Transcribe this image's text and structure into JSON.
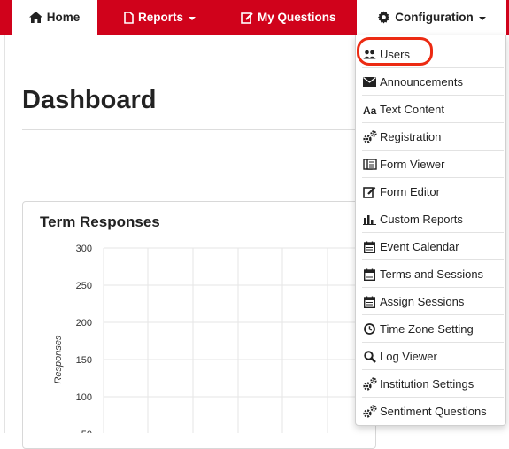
{
  "nav": {
    "home": "Home",
    "reports": "Reports",
    "my_questions": "My Questions",
    "configuration": "Configuration"
  },
  "page": {
    "title": "Dashboard"
  },
  "panel": {
    "title": "Term Responses"
  },
  "chart_data": {
    "type": "bar",
    "title": "Term Responses",
    "ylabel": "Responses",
    "ylim": [
      0,
      300
    ],
    "yticks": [
      300,
      250,
      200,
      150,
      100,
      50
    ],
    "grid": true
  },
  "menu": {
    "items": [
      {
        "label": "Users",
        "icon": "users-icon"
      },
      {
        "label": "Announcements",
        "icon": "envelope-icon"
      },
      {
        "label": "Text Content",
        "icon": "font-icon"
      },
      {
        "label": "Registration",
        "icon": "cogs-icon"
      },
      {
        "label": "Form Viewer",
        "icon": "forms-icon"
      },
      {
        "label": "Form Editor",
        "icon": "edit-icon"
      },
      {
        "label": "Custom Reports",
        "icon": "bar-chart-icon"
      },
      {
        "label": "Event Calendar",
        "icon": "calendar-icon"
      },
      {
        "label": "Terms and Sessions",
        "icon": "calendar-icon"
      },
      {
        "label": "Assign Sessions",
        "icon": "calendar-icon"
      },
      {
        "label": "Time Zone Setting",
        "icon": "clock-icon"
      },
      {
        "label": "Log Viewer",
        "icon": "search-icon"
      },
      {
        "label": "Institution Settings",
        "icon": "cogs-icon"
      },
      {
        "label": "Sentiment Questions",
        "icon": "cogs-icon"
      }
    ]
  },
  "colors": {
    "nav_bg": "#d0021b",
    "highlight": "#ec2a12"
  }
}
